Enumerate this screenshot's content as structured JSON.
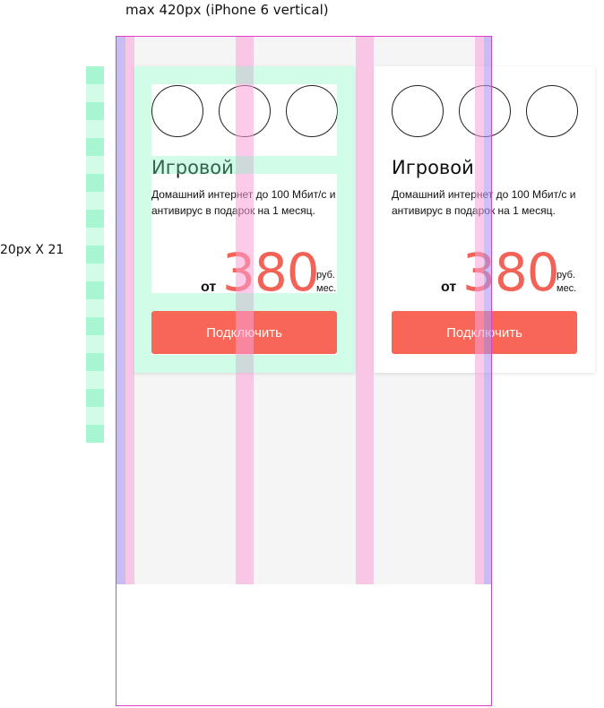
{
  "annotations": {
    "viewport_label": "max 420px (iPhone 6 vertical)",
    "rhythm_label": "20px X 21"
  },
  "cards": [
    {
      "title": "Игровой",
      "description": "Домашний  интернет до 100 Мбит/с и антивирус в подарок на 1 месяц.",
      "price_prefix": "от",
      "price": "380",
      "price_unit_line1": "руб.",
      "price_unit_line2": "мес.",
      "button_label": "Подключить"
    },
    {
      "title": "Игровой",
      "description": "Домашний  интернет до 100 Мбит/с и антивирус в подарок на 1 месяц.",
      "price_prefix": "от",
      "price": "380",
      "price_unit_line1": "руб.",
      "price_unit_line2": "мес.",
      "button_label": "Подключить"
    }
  ],
  "colors": {
    "accent": "#f76657",
    "price": "#f26257",
    "frame": "#e040c8",
    "grid_column": "#faa0d7",
    "gutter": "#aa96f0",
    "baseline": "#a8f5d2"
  }
}
